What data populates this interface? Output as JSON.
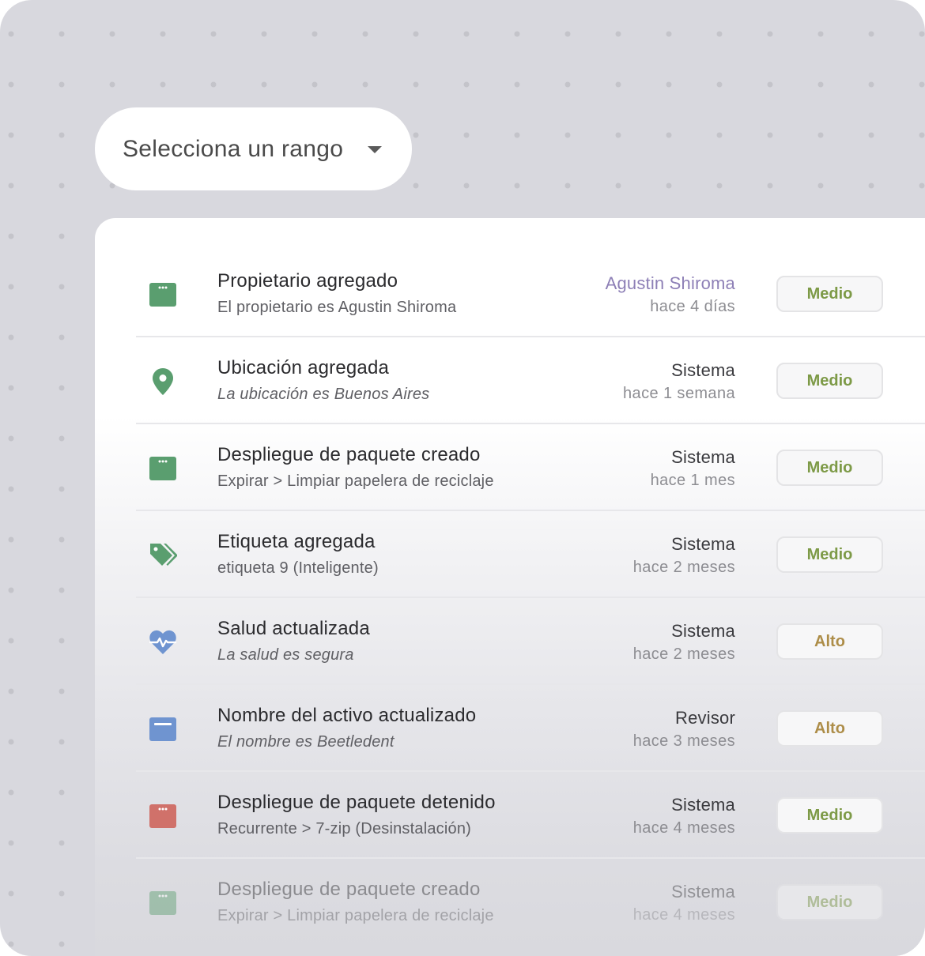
{
  "range_selector": {
    "label": "Selecciona un rango",
    "icon": "caret-down-icon"
  },
  "colors": {
    "green": "#5a9e6f",
    "blue": "#6f94d0",
    "red": "#d0716a",
    "medio": "#7d9a47",
    "alto": "#ad8d48",
    "actor_link": "#8d7fb6"
  },
  "activity": [
    {
      "icon": "app-window-icon",
      "icon_color": "#5a9e6f",
      "title": "Propietario agregado",
      "subtitle": "El propietario es Agustin Shiroma",
      "subtitle_italic": false,
      "actor": "Agustin Shiroma",
      "actor_is_link": true,
      "time": "hace 4 días",
      "priority": "Medio"
    },
    {
      "icon": "location-pin-icon",
      "icon_color": "#5a9e6f",
      "title": "Ubicación agregada",
      "subtitle": "La ubicación es Buenos Aires",
      "subtitle_italic": true,
      "actor": "Sistema",
      "actor_is_link": false,
      "time": "hace 1 semana",
      "priority": "Medio"
    },
    {
      "icon": "app-window-icon",
      "icon_color": "#5a9e6f",
      "title": "Despliegue de paquete creado",
      "subtitle": "Expirar > Limpiar papelera de reciclaje",
      "subtitle_italic": false,
      "actor": "Sistema",
      "actor_is_link": false,
      "time": "hace 1 mes",
      "priority": "Medio"
    },
    {
      "icon": "tags-icon",
      "icon_color": "#5a9e6f",
      "title": "Etiqueta agregada",
      "subtitle": "etiqueta 9 (Inteligente)",
      "subtitle_italic": false,
      "actor": "Sistema",
      "actor_is_link": false,
      "time": "hace 2 meses",
      "priority": "Medio"
    },
    {
      "icon": "heart-pulse-icon",
      "icon_color": "#6f94d0",
      "title": "Salud actualizada",
      "subtitle": "La salud es segura",
      "subtitle_italic": true,
      "actor": "Sistema",
      "actor_is_link": false,
      "time": "hace 2 meses",
      "priority": "Alto"
    },
    {
      "icon": "window-icon",
      "icon_color": "#6f94d0",
      "title": "Nombre del activo actualizado",
      "subtitle": "El nombre es Beetledent",
      "subtitle_italic": true,
      "actor": "Revisor",
      "actor_is_link": false,
      "time": "hace 3 meses",
      "priority": "Alto"
    },
    {
      "icon": "app-window-icon",
      "icon_color": "#d0716a",
      "title": "Despliegue de paquete detenido",
      "subtitle": "Recurrente > 7-zip (Desinstalación)",
      "subtitle_italic": false,
      "actor": "Sistema",
      "actor_is_link": false,
      "time": "hace 4 meses",
      "priority": "Medio"
    },
    {
      "icon": "app-window-icon",
      "icon_color": "#5a9e6f",
      "title": "Despliegue de paquete creado",
      "subtitle": "Expirar > Limpiar papelera de reciclaje",
      "subtitle_italic": false,
      "actor": "Sistema",
      "actor_is_link": false,
      "time": "hace 4 meses",
      "priority": "Medio"
    }
  ]
}
